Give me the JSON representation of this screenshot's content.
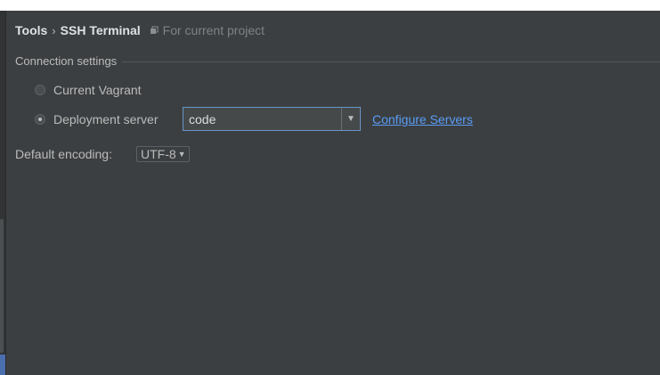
{
  "breadcrumb": {
    "root": "Tools",
    "separator": "›",
    "page": "SSH Terminal",
    "scope_icon": "project-scope-icon",
    "scope_note": "For current project"
  },
  "connection": {
    "group_title": "Connection settings",
    "options": [
      {
        "label": "Current Vagrant",
        "selected": false
      },
      {
        "label": "Deployment server",
        "selected": true
      }
    ],
    "server_select": {
      "value": "code",
      "arrow_icon": "chevron-down-icon"
    },
    "configure_link": "Configure Servers"
  },
  "encoding": {
    "label": "Default encoding:",
    "value": "UTF-8",
    "arrow_icon": "chevron-down-icon"
  },
  "colors": {
    "background": "#3c3f41",
    "text": "#bbbbbb",
    "link": "#589df6",
    "focus_border": "#6895c7"
  }
}
